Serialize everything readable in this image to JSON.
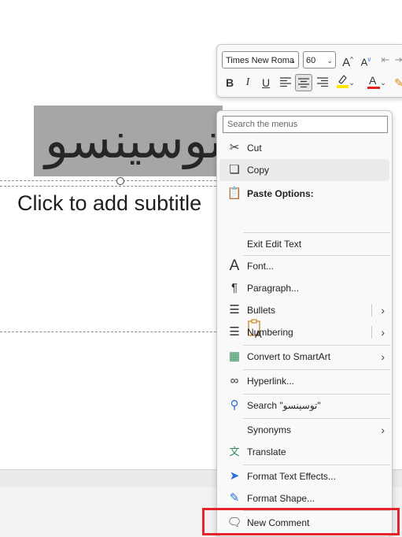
{
  "slide": {
    "title_text": "توسینسو",
    "subtitle_placeholder": "Click to add subtitle"
  },
  "mini_toolbar": {
    "font_name": "Times New Roma",
    "font_size": "60",
    "grow_font": "A",
    "shrink_font": "A",
    "bold": "B",
    "italic": "I",
    "underline": "U",
    "font_color_letter": "A"
  },
  "context_menu": {
    "search_placeholder": "Search the menus",
    "items": [
      {
        "label": "Cut",
        "icon": "scissors-icon"
      },
      {
        "label": "Copy",
        "icon": "copy-icon"
      },
      {
        "label": "Paste Options:",
        "icon": "clipboard-icon"
      },
      {
        "label": "Exit Edit Text"
      },
      {
        "label": "Font...",
        "icon": "font-icon"
      },
      {
        "label": "Paragraph...",
        "icon": "paragraph-icon"
      },
      {
        "label": "Bullets",
        "icon": "bullets-icon"
      },
      {
        "label": "Numbering",
        "icon": "numbering-icon"
      },
      {
        "label": "Convert to SmartArt",
        "icon": "smartart-icon"
      },
      {
        "label": "Hyperlink...",
        "icon": "link-icon"
      },
      {
        "label": "Search \"توسینسو\"",
        "icon": "search-icon"
      },
      {
        "label": "Synonyms"
      },
      {
        "label": "Translate",
        "icon": "translate-icon"
      },
      {
        "label": "Format Text Effects...",
        "icon": "text-effects-icon"
      },
      {
        "label": "Format Shape...",
        "icon": "format-shape-icon"
      },
      {
        "label": "New Comment",
        "icon": "comment-icon"
      }
    ]
  },
  "colors": {
    "highlight_border": "#e2262b",
    "title_box_fill": "#a6a6a6",
    "highlight_yellow": "#ffe600",
    "font_red": "#e02020"
  }
}
